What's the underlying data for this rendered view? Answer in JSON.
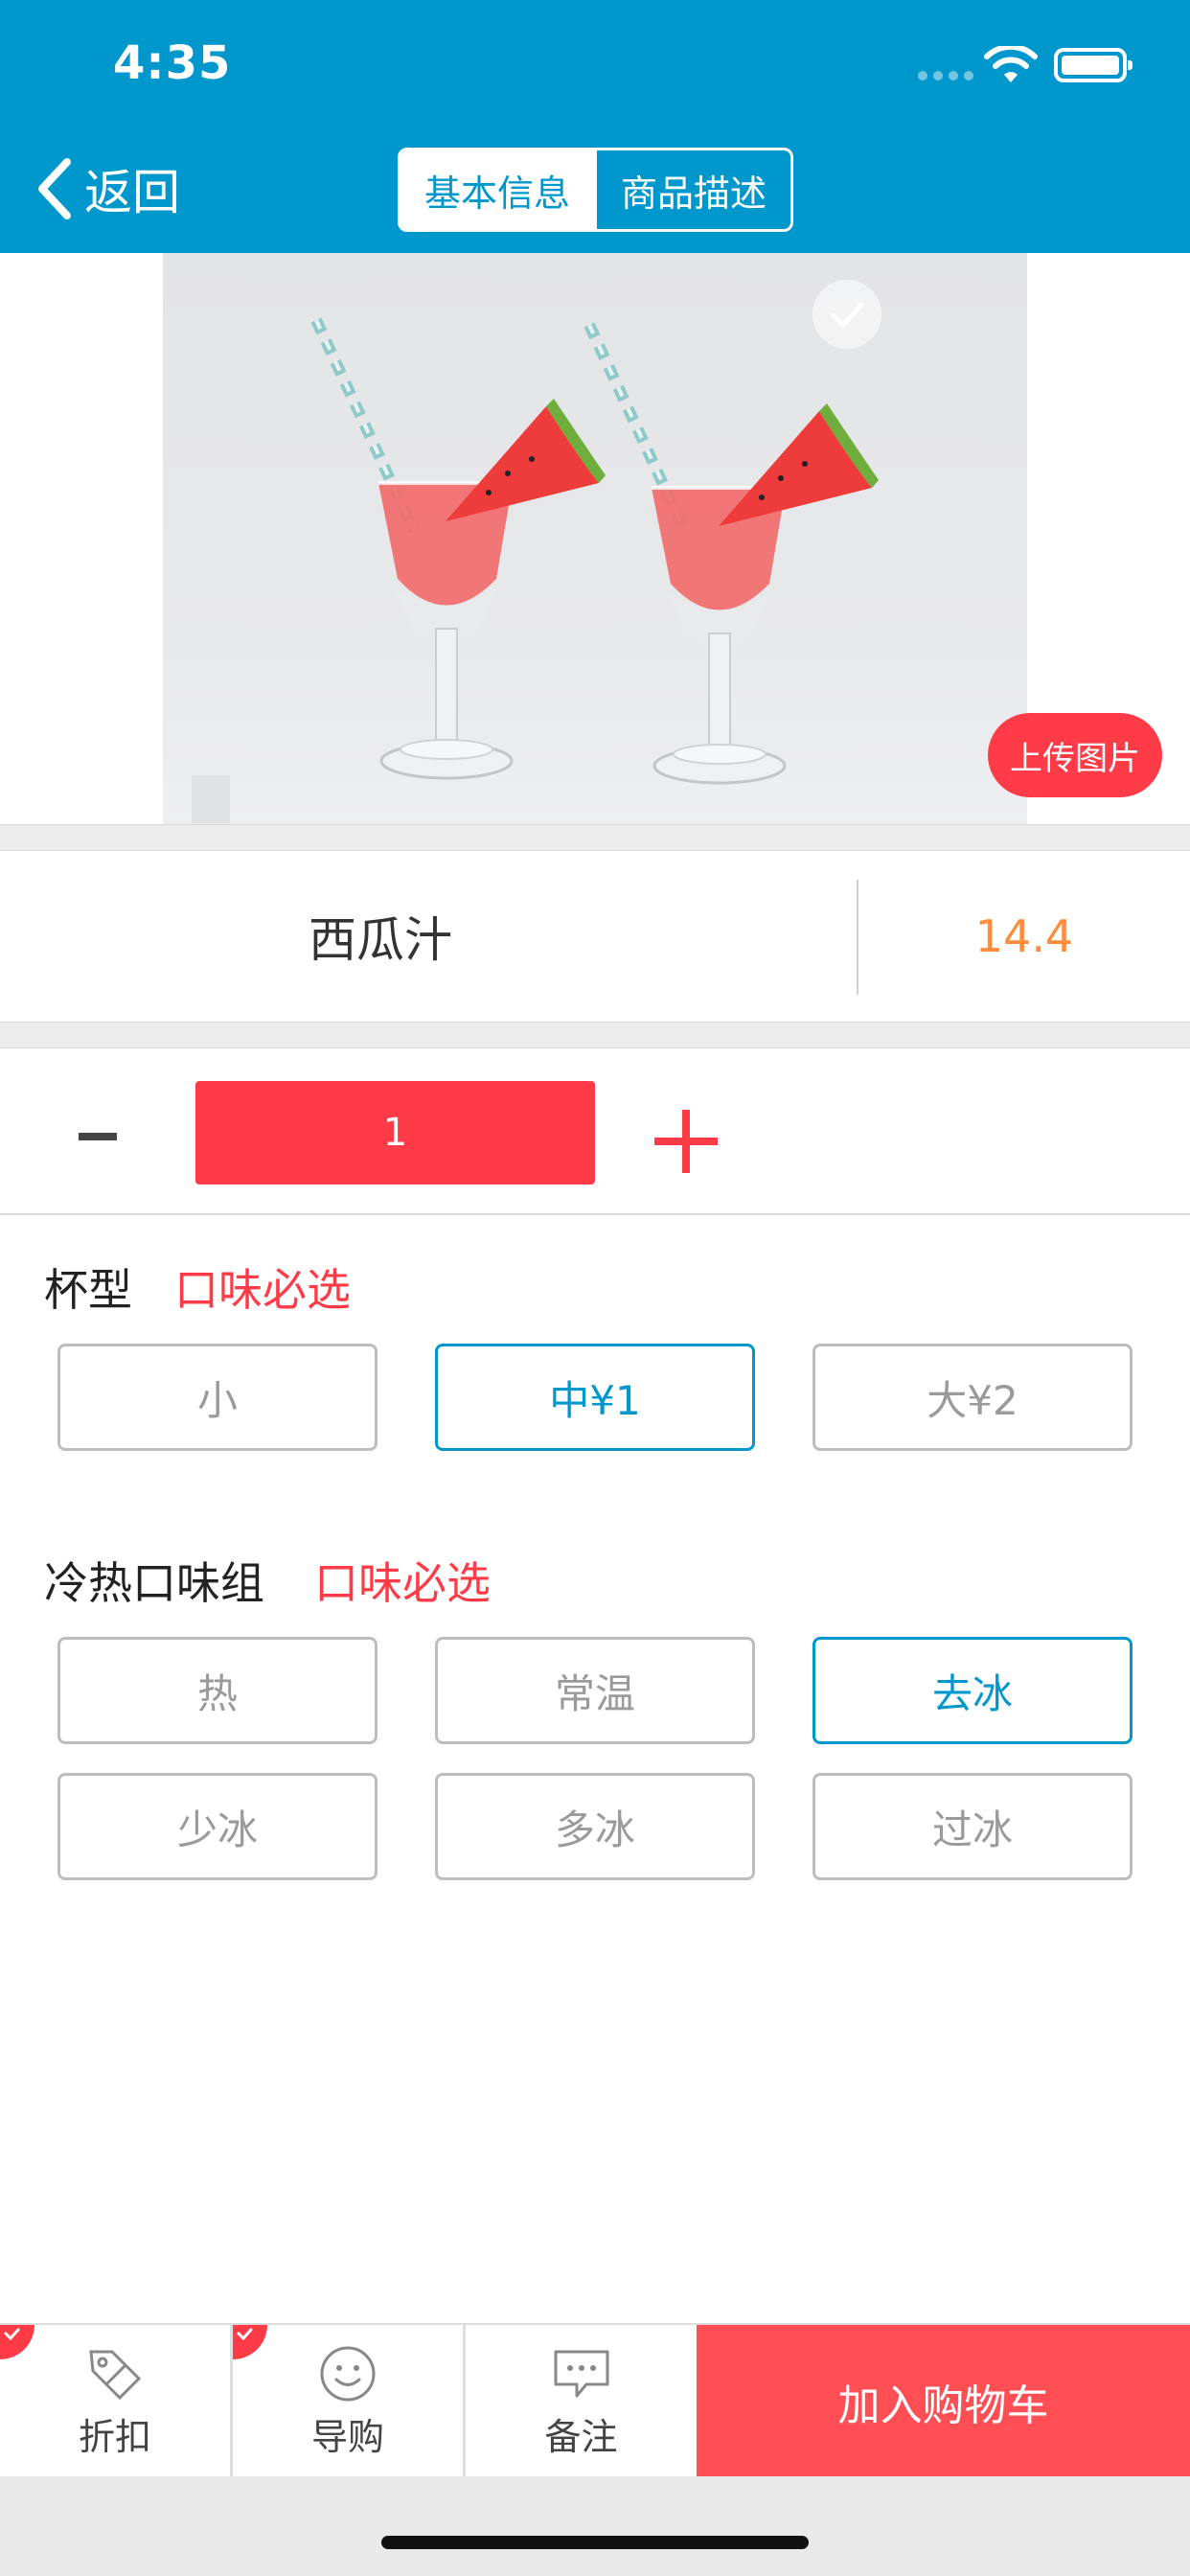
{
  "status_bar": {
    "time": "4:35"
  },
  "nav": {
    "back_label": "返回",
    "tabs": [
      {
        "label": "基本信息",
        "active": true
      },
      {
        "label": "商品描述",
        "active": false
      }
    ]
  },
  "colors": {
    "primary": "#0097cc",
    "accent": "#ff3b47",
    "price": "#ff8c3a",
    "cart": "#ff4f55"
  },
  "image": {
    "upload_label": "上传图片",
    "check_icon": "check-circle-icon"
  },
  "product": {
    "name": "西瓜汁",
    "price": "14.4"
  },
  "quantity": {
    "value": "1"
  },
  "groups": [
    {
      "title": "杯型",
      "required": "口味必选",
      "options": [
        {
          "label": "小",
          "selected": false
        },
        {
          "label": "中¥1",
          "selected": true
        },
        {
          "label": "大¥2",
          "selected": false
        }
      ]
    },
    {
      "title": "冷热口味组",
      "required": "口味必选",
      "options": [
        {
          "label": "热",
          "selected": false
        },
        {
          "label": "常温",
          "selected": false
        },
        {
          "label": "去冰",
          "selected": true
        },
        {
          "label": "少冰",
          "selected": false
        },
        {
          "label": "多冰",
          "selected": false
        },
        {
          "label": "过冰",
          "selected": false
        }
      ]
    }
  ],
  "toolbar": {
    "discount": "折扣",
    "guide": "导购",
    "note": "备注",
    "add_to_cart": "加入购物车"
  }
}
